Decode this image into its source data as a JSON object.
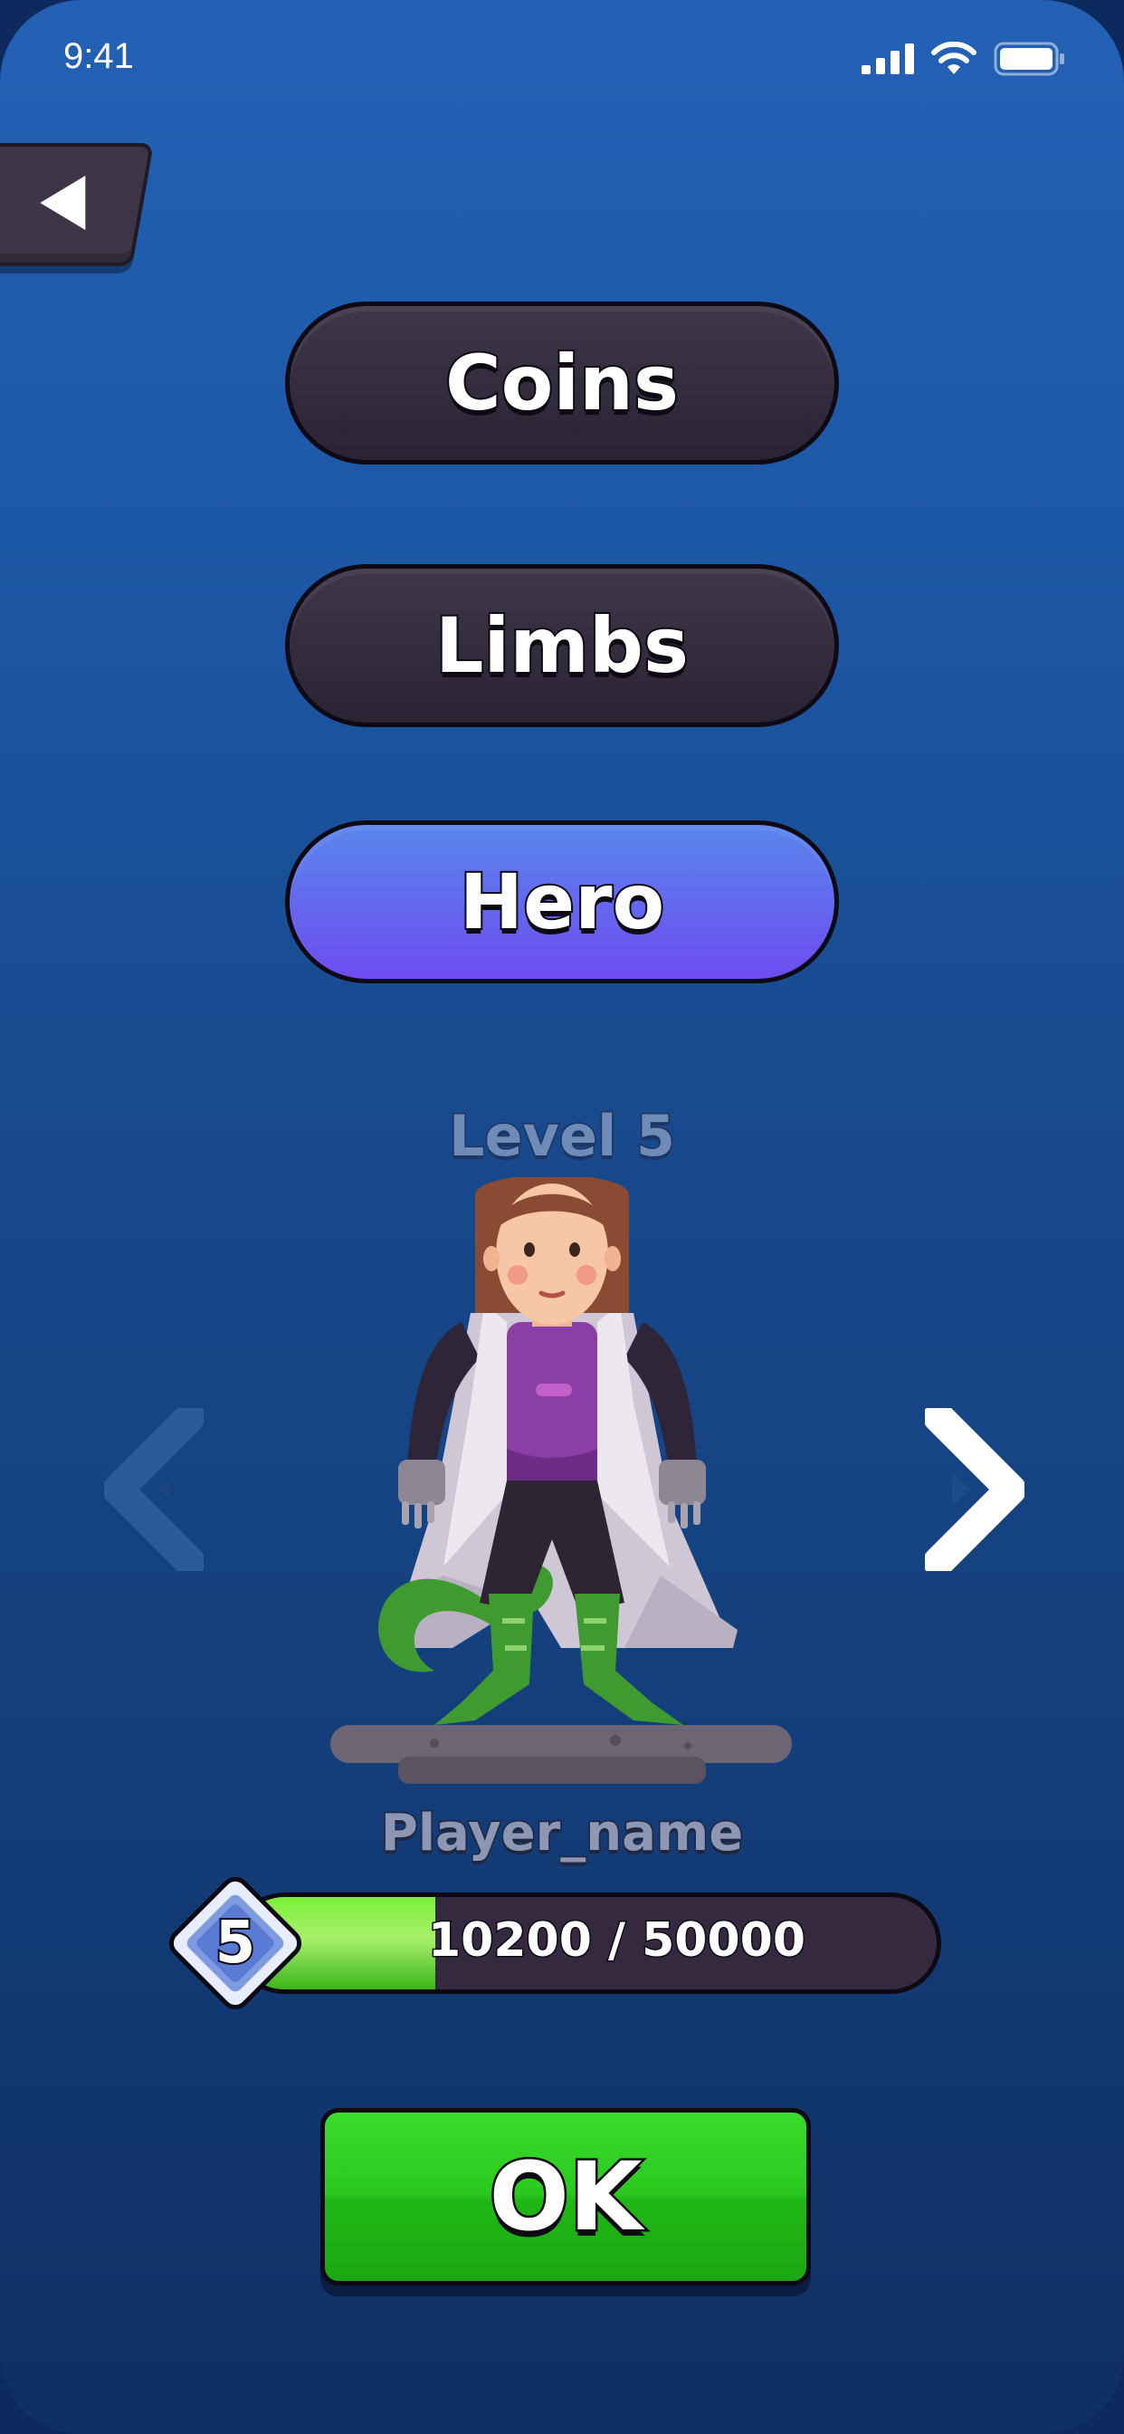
{
  "status": {
    "time": "9:41"
  },
  "menu": {
    "coins_label": "Coins",
    "limbs_label": "Limbs",
    "hero_label": "Hero",
    "active": "Hero"
  },
  "hero": {
    "level_label": "Level 5",
    "player_name": "Player_name"
  },
  "xp": {
    "level": "5",
    "text": "10200 / 50000",
    "fraction": 0.204
  },
  "ok_label": "OK",
  "colors": {
    "active_pill": "#6d4cf0",
    "ok_green": "#2cc81f",
    "xp_green": "#7df03a"
  }
}
